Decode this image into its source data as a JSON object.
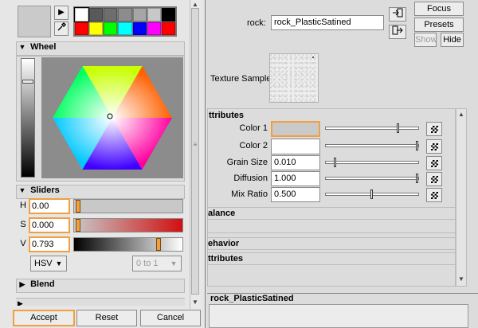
{
  "color_chooser": {
    "tools": {
      "arrow_icon": "triangle-right",
      "eyedropper_icon": "eyedropper"
    },
    "palette": [
      "#ffffff",
      "#595959",
      "#6e6e6e",
      "#8c8c8c",
      "#a6a6a6",
      "#c8c8c8",
      "#000000",
      "#ff0000",
      "#ffff00",
      "#00ff00",
      "#00ffff",
      "#0000ff",
      "#ff00ff",
      "#ff0000"
    ],
    "wheel_section": {
      "label": "Wheel",
      "expanded": true
    },
    "sliders_section": {
      "label": "Sliders",
      "expanded": true,
      "rows": [
        {
          "label": "H",
          "value": "0.00"
        },
        {
          "label": "S",
          "value": "0.000"
        },
        {
          "label": "V",
          "value": "0.793"
        }
      ],
      "mode": "HSV",
      "range": "0 to 1"
    },
    "blend_section": {
      "label": "Blend",
      "expanded": false
    },
    "buttons": {
      "accept": "Accept",
      "reset": "Reset",
      "cancel": "Cancel"
    }
  },
  "editor": {
    "node_label": "rock:",
    "node_name": "rock_PlasticSatined",
    "buttons": {
      "focus": "Focus",
      "presets": "Presets",
      "show": "Show",
      "hide": "Hide"
    },
    "texture_sample_label": "Texture Sample",
    "attributes_header": "ttributes",
    "attributes": [
      {
        "label": "Color 1",
        "value": "",
        "swatch": "#c9c9c9",
        "slider": 0.79
      },
      {
        "label": "Color 2",
        "value": "",
        "swatch": "#ffffff",
        "slider": 1.0
      },
      {
        "label": "Grain Size",
        "value": "0.010",
        "slider": 0.1
      },
      {
        "label": "Diffusion",
        "value": "1.000",
        "slider": 1.0
      },
      {
        "label": "Mix Ratio",
        "value": "0.500",
        "slider": 0.5
      }
    ],
    "collapsed": [
      "alance",
      "ehavior",
      "ttributes"
    ],
    "notes_label": "rock_PlasticSatined"
  }
}
